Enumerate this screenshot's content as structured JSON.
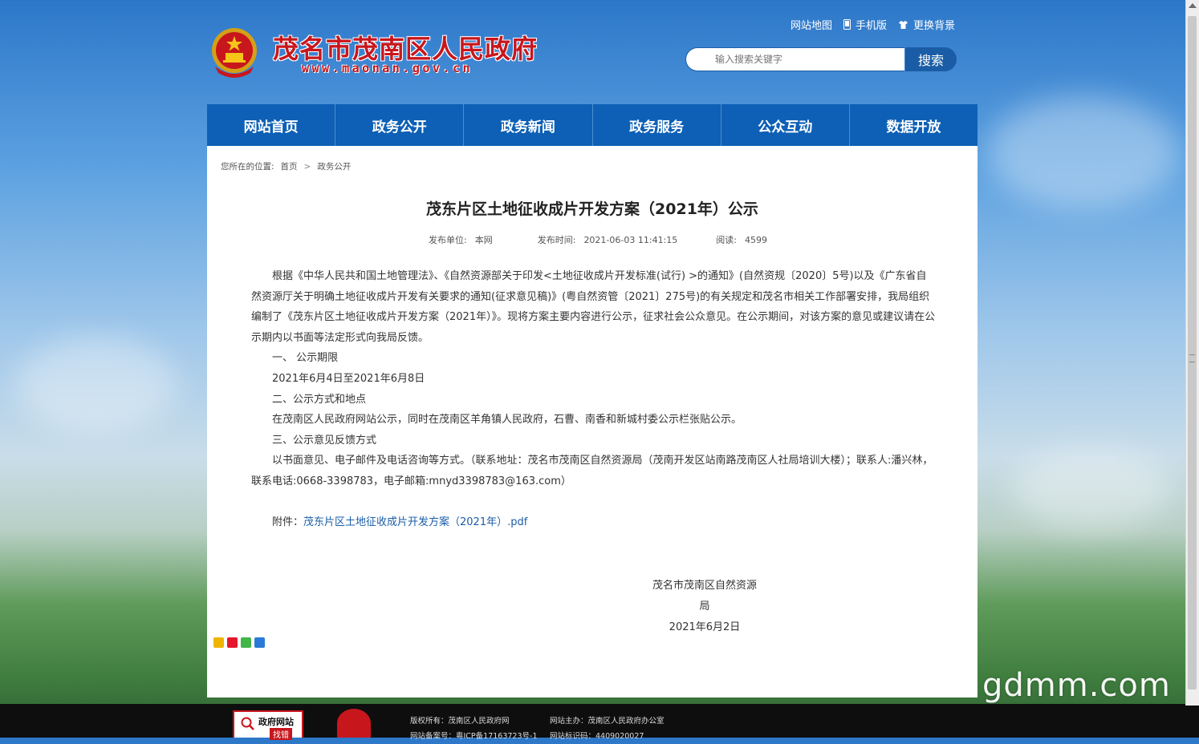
{
  "header": {
    "site_title": "茂名市茂南区人民政府",
    "site_domain": "www.maonan.gov.cn",
    "top_links": {
      "sitemap": "网站地图",
      "mobile": "手机版",
      "background": "更换背景"
    },
    "search": {
      "placeholder": "输入搜索关键字",
      "button": "搜索"
    }
  },
  "nav": {
    "items": [
      "网站首页",
      "政务公开",
      "政务新闻",
      "政务服务",
      "公众互动",
      "数据开放"
    ]
  },
  "breadcrumb": {
    "label": "您所在的位置:",
    "home": "首页",
    "current": "政务公开",
    "sep": ">"
  },
  "article": {
    "title": "茂东片区土地征收成片开发方案（2021年）公示",
    "meta": {
      "publisher_label": "发布单位:",
      "publisher": "本网",
      "time_label": "发布时间:",
      "time": "2021-06-03 11:41:15",
      "reads_label": "阅读:",
      "reads": "4599"
    },
    "paragraphs": [
      "根据《中华人民共和国土地管理法》、《自然资源部关于印发<土地征收成片开发标准(试行) >的通知》(自然资规〔2020〕5号)以及《广东省自然资源厅关于明确土地征收成片开发有关要求的通知(征求意见稿)》(粤自然资管〔2021〕275号)的有关规定和茂名市相关工作部署安排，我局组织编制了《茂东片区土地征收成片开发方案（2021年）》。现将方案主要内容进行公示，征求社会公众意见。在公示期间，对该方案的意见或建议请在公示期内以书面等法定形式向我局反馈。",
      "一、 公示期限",
      "2021年6月4日至2021年6月8日",
      "二、公示方式和地点",
      "在茂南区人民政府网站公示，同时在茂南区羊角镇人民政府，石曹、南香和新城村委公示栏张贴公示。",
      "三、公示意见反馈方式",
      "以书面意见、电子邮件及电话咨询等方式。（联系地址：茂名市茂南区自然资源局（茂南开发区站南路茂南区人社局培训大楼）；联系人:潘兴林，联系电话:0668-3398783，电子邮箱:mnyd3398783@163.com）"
    ],
    "attachment_label": "附件：",
    "attachment_link": "茂东片区土地征收成片开发方案（2021年）.pdf",
    "signature_org": "茂名市茂南区自然资源局",
    "signature_date": "2021年6月2日"
  },
  "watermark": "gdmm.com",
  "footer": {
    "badge_text": "政府网站",
    "badge_sub": "找错",
    "copyright": "版权所有：茂南区人民政府网",
    "icp": "网站备案号：粤ICP备17163723号-1",
    "host": "网站主办：茂南区人民政府办公室",
    "site_id": "网站标识码：4409020027"
  },
  "colors": {
    "brand_red": "#c8161d",
    "nav_blue": "#0d60b5",
    "link_blue": "#1a5da6"
  }
}
